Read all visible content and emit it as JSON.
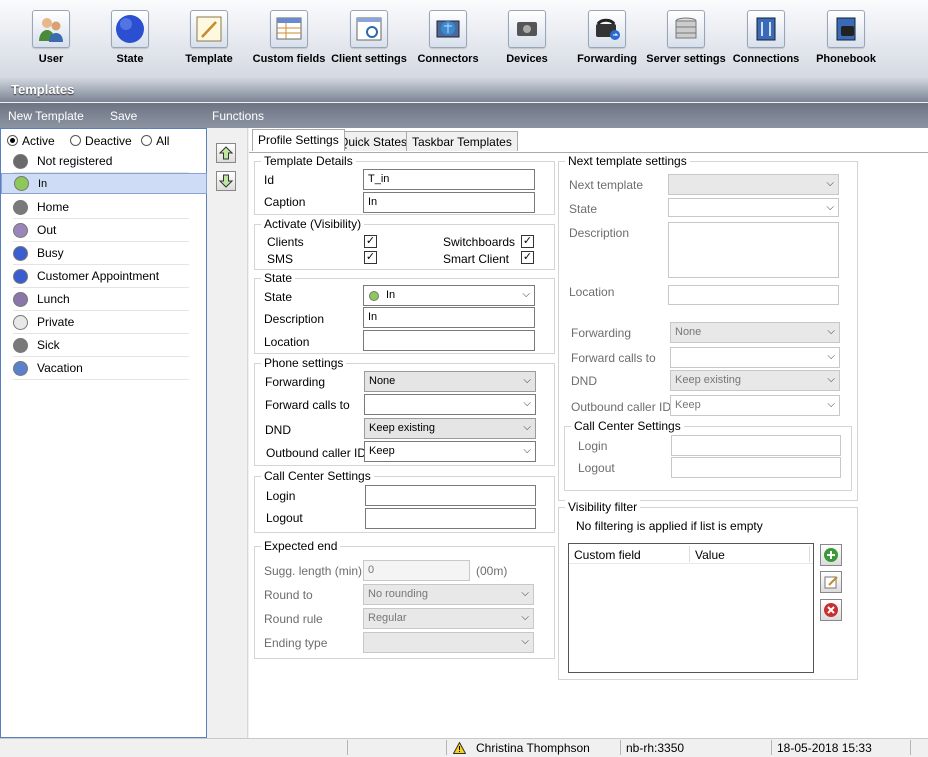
{
  "toolbar": {
    "items": [
      {
        "label": "User",
        "icon": "user-icon"
      },
      {
        "label": "State",
        "icon": "globe-state-icon"
      },
      {
        "label": "Template",
        "icon": "template-icon"
      },
      {
        "label": "Custom fields",
        "icon": "custom-fields-icon"
      },
      {
        "label": "Client settings",
        "icon": "client-settings-icon"
      },
      {
        "label": "Connectors",
        "icon": "connectors-icon"
      },
      {
        "label": "Devices",
        "icon": "devices-icon"
      },
      {
        "label": "Forwarding",
        "icon": "forwarding-icon"
      },
      {
        "label": "Server settings",
        "icon": "server-settings-icon"
      },
      {
        "label": "Connections",
        "icon": "connections-icon"
      },
      {
        "label": "Phonebook",
        "icon": "phonebook-icon"
      }
    ]
  },
  "title": "Templates",
  "menu": {
    "new_template": "New Template",
    "save": "Save",
    "functions": "Functions"
  },
  "filter": {
    "active": "Active",
    "deactive": "Deactive",
    "all": "All",
    "selected": "Active"
  },
  "states": [
    {
      "label": "Not registered",
      "color": "#6a6a6a"
    },
    {
      "label": "In",
      "color": "#8cc85a"
    },
    {
      "label": "Home",
      "color": "#7a7a7a"
    },
    {
      "label": "Out",
      "color": "#9a86b8"
    },
    {
      "label": "Busy",
      "color": "#3a5ed0"
    },
    {
      "label": "Customer Appointment",
      "color": "#3a5ed0"
    },
    {
      "label": "Lunch",
      "color": "#8a76a8"
    },
    {
      "label": "Private",
      "color": "#e8e8e8"
    },
    {
      "label": "Sick",
      "color": "#7a7a7a"
    },
    {
      "label": "Vacation",
      "color": "#5a82cc"
    }
  ],
  "tabs": [
    "Profile Settings",
    "Quick States",
    "Taskbar Templates"
  ],
  "template_details": {
    "title": "Template Details",
    "id_label": "Id",
    "id_value": "T_in",
    "caption_label": "Caption",
    "caption_value": "In"
  },
  "visibility": {
    "title": "Activate (Visibility)",
    "clients": "Clients",
    "sms": "SMS",
    "switchboards": "Switchboards",
    "smart_client": "Smart Client"
  },
  "state_group": {
    "title": "State",
    "state_label": "State",
    "state_value": "In",
    "description_label": "Description",
    "description_value": "In",
    "location_label": "Location",
    "location_value": ""
  },
  "phone": {
    "title": "Phone settings",
    "forwarding_label": "Forwarding",
    "forwarding_value": "None",
    "forward_calls_label": "Forward calls to",
    "forward_calls_value": "",
    "dnd_label": "DND",
    "dnd_value": "Keep existing",
    "outbound_label": "Outbound caller ID",
    "outbound_value": "Keep"
  },
  "call_center": {
    "title": "Call Center Settings",
    "login_label": "Login",
    "logout_label": "Logout"
  },
  "expected_end": {
    "title": "Expected end",
    "sugg_label": "Sugg. length (min)",
    "sugg_value": "0",
    "sugg_suffix": "(00m)",
    "round_to_label": "Round to",
    "round_to_value": "No rounding",
    "round_rule_label": "Round rule",
    "round_rule_value": "Regular",
    "ending_type_label": "Ending type",
    "ending_type_value": ""
  },
  "next": {
    "title": "Next template settings",
    "next_template_label": "Next template",
    "state_label": "State",
    "description_label": "Description",
    "location_label": "Location",
    "forwarding_label": "Forwarding",
    "forwarding_value": "None",
    "forward_calls_label": "Forward calls to",
    "dnd_label": "DND",
    "dnd_value": "Keep existing",
    "outbound_label": "Outbound caller ID",
    "outbound_value": "Keep"
  },
  "next_call_center": {
    "title": "Call Center Settings",
    "login_label": "Login",
    "logout_label": "Logout"
  },
  "visibility_filter": {
    "title": "Visibility filter",
    "hint": "No filtering is applied if list is empty",
    "col_custom_field": "Custom field",
    "col_value": "Value"
  },
  "status": {
    "user": "Christina Thomphson",
    "server": "nb-rh:3350",
    "datetime": "18-05-2018 15:33"
  }
}
